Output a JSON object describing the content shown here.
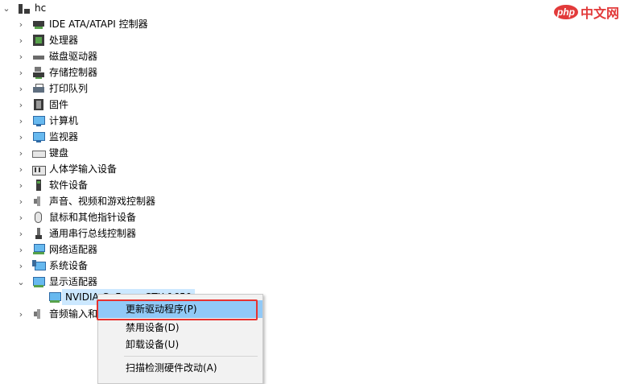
{
  "root": {
    "label": "hc"
  },
  "categories": [
    {
      "label": "IDE ATA/ATAPI 控制器",
      "icon": "ide-controller-icon"
    },
    {
      "label": "处理器",
      "icon": "processor-icon"
    },
    {
      "label": "磁盘驱动器",
      "icon": "disk-drive-icon"
    },
    {
      "label": "存储控制器",
      "icon": "storage-controller-icon"
    },
    {
      "label": "打印队列",
      "icon": "printer-icon"
    },
    {
      "label": "固件",
      "icon": "firmware-icon"
    },
    {
      "label": "计算机",
      "icon": "computer-icon"
    },
    {
      "label": "监视器",
      "icon": "monitor-icon"
    },
    {
      "label": "键盘",
      "icon": "keyboard-icon"
    },
    {
      "label": "人体学输入设备",
      "icon": "hid-icon"
    },
    {
      "label": "软件设备",
      "icon": "software-device-icon"
    },
    {
      "label": "声音、视频和游戏控制器",
      "icon": "speaker-icon"
    },
    {
      "label": "鼠标和其他指针设备",
      "icon": "mouse-icon"
    },
    {
      "label": "通用串行总线控制器",
      "icon": "usb-icon"
    },
    {
      "label": "网络适配器",
      "icon": "network-adapter-icon"
    },
    {
      "label": "系统设备",
      "icon": "system-device-icon"
    },
    {
      "label": "显示适配器",
      "icon": "display-adapter-icon",
      "expanded": true
    }
  ],
  "display_child": {
    "label": "NVIDIA GeForce GTX 1650",
    "icon": "gpu-icon"
  },
  "last_category": {
    "label": "音频输入和",
    "icon": "audio-io-icon"
  },
  "context_menu": {
    "items": [
      {
        "label": "更新驱动程序(P)",
        "highlighted": true
      },
      {
        "label": "禁用设备(D)"
      },
      {
        "label": "卸载设备(U)"
      },
      {
        "label": "扫描检测硬件改动(A)"
      }
    ]
  },
  "watermark": {
    "badge": "php",
    "text": "中文网"
  },
  "colors": {
    "menu_highlight": "#91c9f7",
    "annotation_box": "#e8322f",
    "selection": "#cce8ff"
  }
}
